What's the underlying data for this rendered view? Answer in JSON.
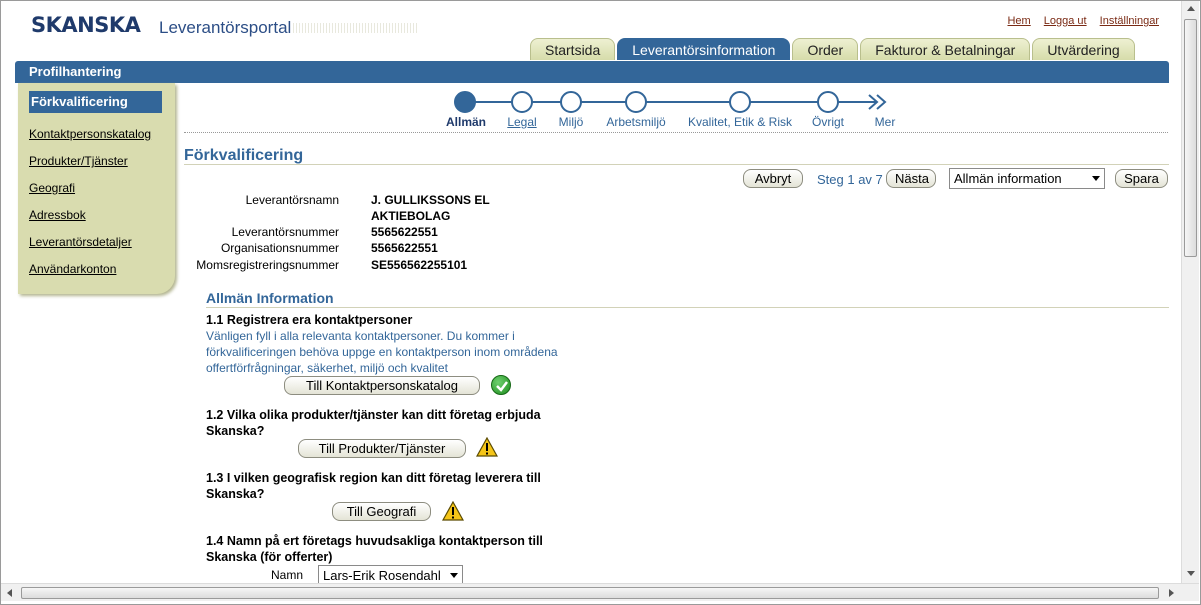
{
  "header": {
    "logo": "SKANSKA",
    "portal_title": "Leverantörsportal",
    "links": [
      "Hem",
      "Logga ut",
      "Inställningar"
    ]
  },
  "tabs": [
    {
      "label": "Startsida",
      "active": false
    },
    {
      "label": "Leverantörsinformation",
      "active": true
    },
    {
      "label": "Order",
      "active": false
    },
    {
      "label": "Fakturor & Betalningar",
      "active": false
    },
    {
      "label": "Utvärdering",
      "active": false
    }
  ],
  "profile_bar": {
    "title": "Profilhantering"
  },
  "sidebar": {
    "items": [
      "Förkvalificering",
      "Kontaktpersonskatalog",
      "Produkter/Tjänster",
      "Geografi",
      "Adressbok",
      "Leverantörsdetaljer",
      "Användarkonton"
    ],
    "active_index": 0
  },
  "train": {
    "steps": [
      "Allmän",
      "Legal",
      "Miljö",
      "Arbetsmiljö",
      "Kvalitet, Etik & Risk",
      "Övrigt",
      "Mer"
    ],
    "current_index": 0
  },
  "page": {
    "title": "Förkvalificering",
    "cancel_label": "Avbryt",
    "step_text": "Steg 1 av 7",
    "next_label": "Nästa",
    "section_select": "Allmän information",
    "save_label": "Spara"
  },
  "supplier": {
    "name_label": "Leverantörsnamn",
    "name_line1": "J. GULLIKSSONS EL",
    "name_line2": "AKTIEBOLAG",
    "number_label": "Leverantörsnummer",
    "number": "5565622551",
    "org_label": "Organisationsnummer",
    "org": "5565622551",
    "vat_label": "Momsregistreringsnummer",
    "vat": "SE556562255101"
  },
  "general": {
    "section_title": "Allmän Information",
    "q1": "1.1 Registrera era kontaktpersoner",
    "q1_hint_1": "Vänligen fyll i alla relevanta kontaktpersoner. Du kommer i",
    "q1_hint_2": "förkvalificeringen behöva uppge en kontaktperson inom områdena",
    "q1_hint_3": "offertförfrågningar, säkerhet, miljö och kvalitet",
    "q1_button": "Till Kontaktpersonskatalog",
    "q2_1": "1.2 Vilka olika produkter/tjänster kan ditt företag erbjuda",
    "q2_2": "Skanska?",
    "q2_button": "Till Produkter/Tjänster",
    "q3_1": "1.3 I vilken geografisk region kan ditt företag leverera till",
    "q3_2": "Skanska?",
    "q3_button": "Till Geografi",
    "q4_1": "1.4 Namn på ert företags huvudsakliga kontaktperson till",
    "q4_2": "Skanska (för offerter)",
    "name_label": "Namn",
    "name_value": "Lars-Erik Rosendahl"
  },
  "colors": {
    "brand_blue": "#336699",
    "tab_bg": "#d6dcaa",
    "sidebar_bg": "#d9dcaf"
  }
}
